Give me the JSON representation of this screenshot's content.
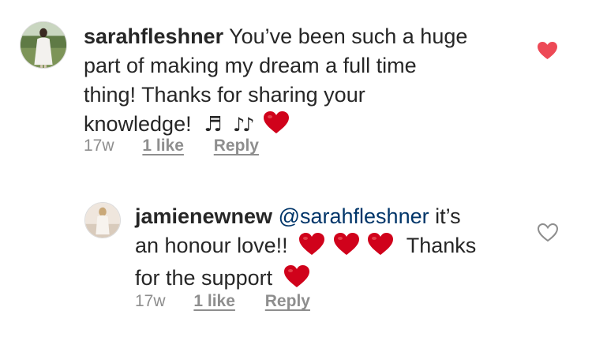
{
  "comments": [
    {
      "username": "sarahfleshner",
      "text_line1": "You’ve been such a huge",
      "text_line2": "part of making my dream a full time",
      "text_line3": "thing! Thanks for sharing your",
      "text_line4": "knowledge!",
      "emoji_notes1": "♬",
      "emoji_notes2": "♪♪",
      "time": "17w",
      "likes": "1 like",
      "reply": "Reply",
      "liked": true,
      "heart_icon": "heart-filled-icon"
    },
    {
      "username": "jamienewnew",
      "mention": "@sarahfleshner",
      "text_line1_rest": "it’s",
      "text_line2": "an honour love!!",
      "text_line2_rest": "Thanks",
      "text_line3": "for the support",
      "time": "17w",
      "likes": "1 like",
      "reply": "Reply",
      "liked": false,
      "heart_icon": "heart-outline-icon"
    }
  ],
  "colors": {
    "text": "#262626",
    "muted": "#8e8e8e",
    "mention": "#003569",
    "like_red": "#ed4956",
    "emoji_heart": "#d0021b"
  }
}
